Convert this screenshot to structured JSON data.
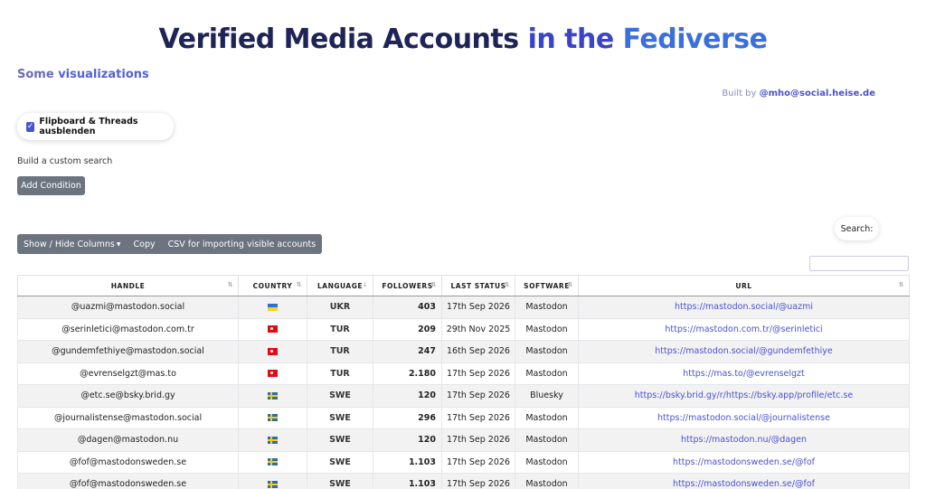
{
  "header": {
    "title_part1": "Verified Media Accounts",
    "title_part2": "in the",
    "title_part3": "Fediverse"
  },
  "viz": {
    "prefix": "Some",
    "link": "visualizations"
  },
  "builtby": {
    "prefix": "Built by",
    "handle": "@mho@social.heise.de"
  },
  "toggle": {
    "label": "Flipboard & Threads ausblenden",
    "checked": true
  },
  "custom_search": {
    "label": "Build a custom search",
    "add_button": "Add Condition"
  },
  "toolbar": {
    "show_hide": "Show / Hide Columns",
    "copy": "Copy",
    "csv": "CSV for importing visible accounts"
  },
  "search": {
    "label": "Search:"
  },
  "table": {
    "columns": [
      "HANDLE",
      "COUNTRY",
      "LANGUAGE",
      "FOLLOWERS",
      "LAST STATUS",
      "SOFTWARE",
      "URL"
    ],
    "rows": [
      {
        "handle": "@uazmi@mastodon.social",
        "flag": "ua",
        "lang": "UKR",
        "followers": "403",
        "last": "17th Sep 2026",
        "software": "Mastodon",
        "url": "https://mastodon.social/@uazmi"
      },
      {
        "handle": "@serinletici@mastodon.com.tr",
        "flag": "tr",
        "lang": "TUR",
        "followers": "209",
        "last": "29th Nov 2025",
        "software": "Mastodon",
        "url": "https://mastodon.com.tr/@serinletici"
      },
      {
        "handle": "@gundemfethiye@mastodon.social",
        "flag": "tr",
        "lang": "TUR",
        "followers": "247",
        "last": "16th Sep 2026",
        "software": "Mastodon",
        "url": "https://mastodon.social/@gundemfethiye"
      },
      {
        "handle": "@evrenselgzt@mas.to",
        "flag": "tr",
        "lang": "TUR",
        "followers": "2.180",
        "last": "17th Sep 2026",
        "software": "Mastodon",
        "url": "https://mas.to/@evrenselgzt"
      },
      {
        "handle": "@etc.se@bsky.brid.gy",
        "flag": "se",
        "lang": "SWE",
        "followers": "120",
        "last": "17th Sep 2026",
        "software": "Bluesky",
        "url": "https://bsky.brid.gy/r/https://bsky.app/profile/etc.se"
      },
      {
        "handle": "@journalistense@mastodon.social",
        "flag": "se",
        "lang": "SWE",
        "followers": "296",
        "last": "17th Sep 2026",
        "software": "Mastodon",
        "url": "https://mastodon.social/@journalistense"
      },
      {
        "handle": "@dagen@mastodon.nu",
        "flag": "se",
        "lang": "SWE",
        "followers": "120",
        "last": "17th Sep 2026",
        "software": "Mastodon",
        "url": "https://mastodon.nu/@dagen"
      },
      {
        "handle": "@fof@mastodonsweden.se",
        "flag": "se",
        "lang": "SWE",
        "followers": "1.103",
        "last": "17th Sep 2026",
        "software": "Mastodon",
        "url": "https://mastodonsweden.se/@fof"
      },
      {
        "handle": "@fof@mastodonsweden.se",
        "flag": "se",
        "lang": "SWE",
        "followers": "1.103",
        "last": "17th Sep 2026",
        "software": "Mastodon",
        "url": "https://mastodonsweden.se/@fof"
      }
    ]
  }
}
